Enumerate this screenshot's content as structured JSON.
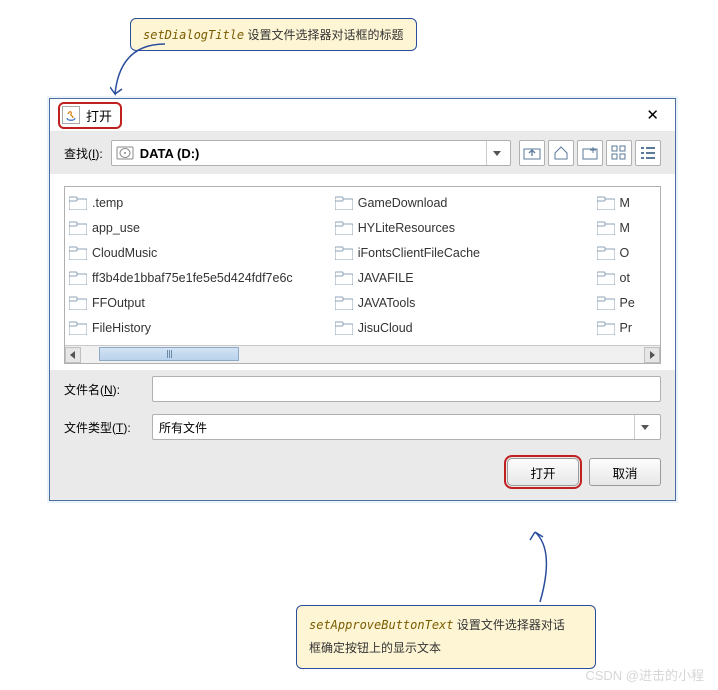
{
  "annotations": {
    "top": {
      "code": "setDialogTitle",
      "text": " 设置文件选择器对话框的标题"
    },
    "bottom": {
      "code": "setApproveButtonText",
      "line1": " 设置文件选择器对话",
      "line2": "框确定按钮上的显示文本"
    }
  },
  "dialog": {
    "title": "打开",
    "lookin_label": "查找(",
    "lookin_key": "I",
    "lookin_suffix": "):",
    "lookin_value": "DATA (D:)",
    "filename_label": "文件名(",
    "filename_key": "N",
    "filename_suffix": "):",
    "filename_value": "",
    "filetype_label": "文件类型(",
    "filetype_key": "T",
    "filetype_suffix": "):",
    "filetype_value": "所有文件",
    "approve": "打开",
    "cancel": "取消"
  },
  "files": {
    "col1": [
      ".temp",
      "app_use",
      "CloudMusic",
      "ff3b4de1bbaf75e1fe5e5d424fdf7e6c",
      "FFOutput",
      "FileHistory"
    ],
    "col2": [
      "GameDownload",
      "HYLiteResources",
      "iFontsClientFileCache",
      "JAVAFILE",
      "JAVATools",
      "JisuCloud"
    ],
    "col3": [
      "M",
      "M",
      "O",
      "ot",
      "Pe",
      "Pr"
    ]
  },
  "watermark": "CSDN @进击的小程"
}
